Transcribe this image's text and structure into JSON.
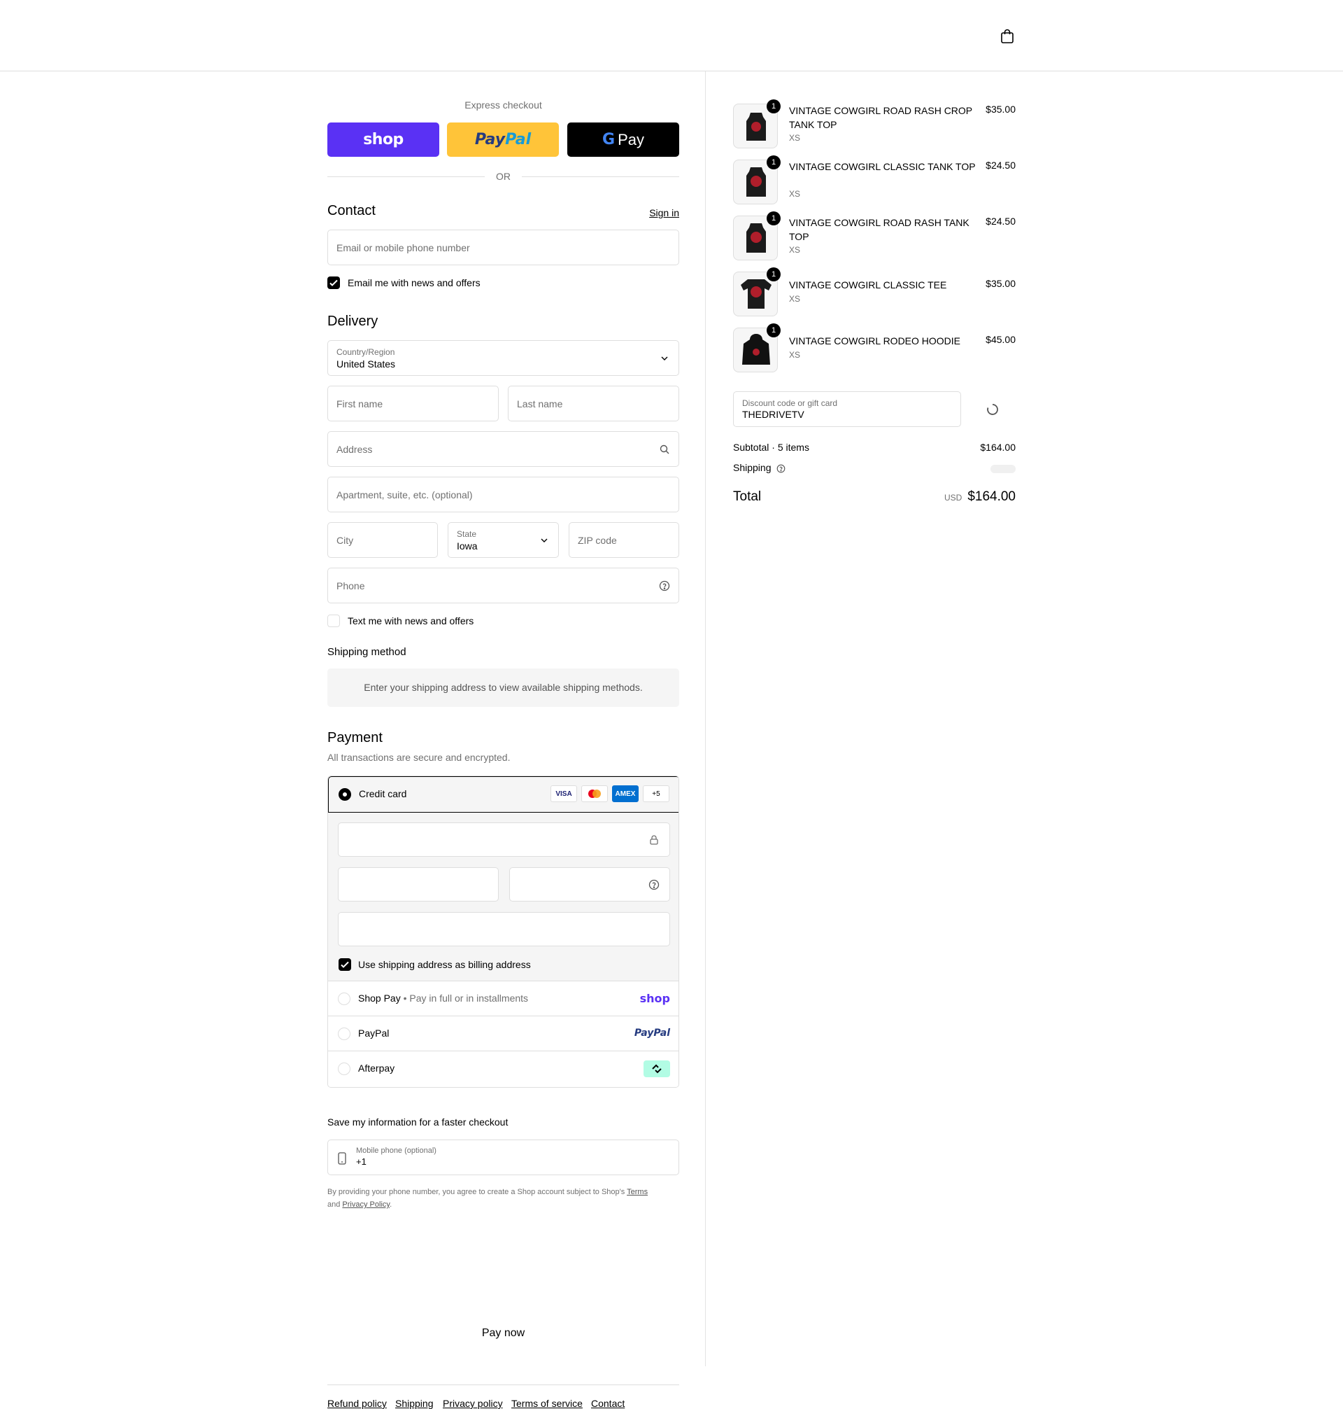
{
  "express": {
    "label": "Express checkout",
    "shop_label": "shop",
    "paypal_label_a": "Pay",
    "paypal_label_b": "Pal",
    "gpay_g": "G",
    "gpay_label": "Pay",
    "or": "OR"
  },
  "contact": {
    "title": "Contact",
    "sign_in": "Sign in",
    "email_placeholder": "Email or mobile phone number",
    "news_label": "Email me with news and offers"
  },
  "delivery": {
    "title": "Delivery",
    "country_label": "Country/Region",
    "country_value": "United States",
    "first_name": "First name",
    "last_name": "Last name",
    "address": "Address",
    "apartment": "Apartment, suite, etc. (optional)",
    "city": "City",
    "state_label": "State",
    "state_value": "Iowa",
    "zip": "ZIP code",
    "phone": "Phone",
    "text_label": "Text me with news and offers"
  },
  "shipping_method": {
    "title": "Shipping method",
    "message": "Enter your shipping address to view available shipping methods."
  },
  "payment": {
    "title": "Payment",
    "subtitle": "All transactions are secure and encrypted.",
    "credit_card": "Credit card",
    "card_more": "+5",
    "card_visa": "VISA",
    "card_amex": "AMEX",
    "billing_label": "Use shipping address as billing address",
    "shoppay": "Shop Pay",
    "shoppay_sub": "Pay in full or in installments",
    "shoppay_logo": "shop",
    "paypal": "PayPal",
    "paypal_logo": "PayPal",
    "afterpay": "Afterpay"
  },
  "save_info": {
    "title": "Save my information for a faster checkout",
    "mobile_label": "Mobile phone (optional)",
    "mobile_value": "+1",
    "legal_a": "By providing your phone number, you agree to create a Shop account subject to Shop's ",
    "legal_terms": "Terms",
    "legal_b": "and ",
    "legal_privacy": "Privacy Policy",
    "legal_c": "."
  },
  "pay_now": "Pay now",
  "footer": {
    "links": [
      "Refund policy",
      "Shipping",
      "Privacy policy",
      "Terms of service",
      "Contact"
    ]
  },
  "cart": {
    "items": [
      {
        "name": "VINTAGE COWGIRL ROAD RASH CROP TANK TOP",
        "size": "XS",
        "price": "$35.00",
        "qty": "1"
      },
      {
        "name": "VINTAGE COWGIRL CLASSIC TANK TOP",
        "size": "XS",
        "price": "$24.50",
        "qty": "1"
      },
      {
        "name": "VINTAGE COWGIRL ROAD RASH TANK TOP",
        "size": "XS",
        "price": "$24.50",
        "qty": "1"
      },
      {
        "name": "VINTAGE COWGIRL CLASSIC TEE",
        "size": "XS",
        "price": "$35.00",
        "qty": "1"
      },
      {
        "name": "VINTAGE COWGIRL RODEO HOODIE",
        "size": "XS",
        "price": "$45.00",
        "qty": "1"
      }
    ],
    "discount_label": "Discount code or gift card",
    "discount_value": "THEDRIVETV",
    "subtotal_label": "Subtotal · 5 items",
    "subtotal_value": "$164.00",
    "shipping_label": "Shipping",
    "total_label": "Total",
    "total_currency": "USD",
    "total_value": "$164.00"
  },
  "colors": {
    "shop_purple": "#5a31f4",
    "paypal_yellow": "#ffc439",
    "afterpay_mint": "#b2fce4"
  }
}
